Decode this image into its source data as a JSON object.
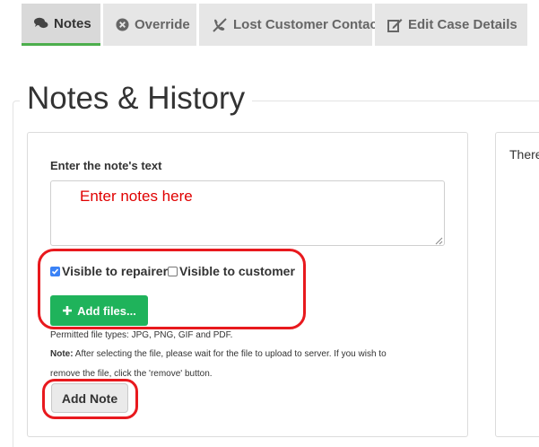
{
  "tabs": [
    {
      "label": "Notes",
      "icon": "comments-icon",
      "active": true
    },
    {
      "label": "Override",
      "icon": "times-circle-icon",
      "active": false
    },
    {
      "label": "Lost Customer Contact",
      "icon": "phone-slash-icon",
      "active": false
    },
    {
      "label": "Edit Case Details",
      "icon": "edit-icon",
      "active": false
    }
  ],
  "page": {
    "title": "Notes & History"
  },
  "form": {
    "note_label": "Enter the note's text",
    "note_value": "Enter notes here",
    "checkboxes": [
      {
        "label": "Visible to repairer",
        "checked": true
      },
      {
        "label": "Visible to customer",
        "checked": false
      }
    ],
    "add_files_label": "Add files...",
    "permitted_types": "Permitted file types: JPG, PNG, GIF and PDF.",
    "note_prefix": "Note:",
    "note_line1": " After selecting the file, please wait for the file to upload to server. If you wish to",
    "note_line2": "remove the file, click the 'remove' button.",
    "add_note_label": "Add Note"
  },
  "right_panel": {
    "text": "There"
  },
  "colors": {
    "accent_green": "#1fb35b",
    "active_tab_underline": "#4cae4c",
    "highlight": "#e8191e",
    "placeholder_red": "#e00000"
  }
}
